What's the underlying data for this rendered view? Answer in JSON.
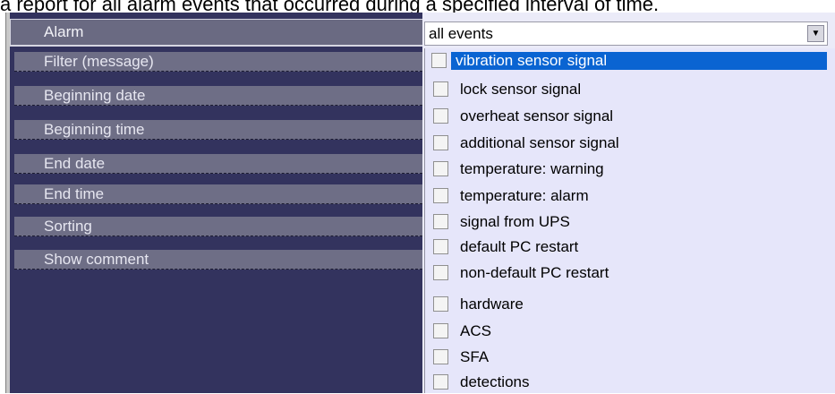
{
  "caption": "a report for all alarm events that occurred during a specified interval of time.",
  "properties": {
    "rows": [
      {
        "label": "Alarm"
      },
      {
        "label": "Filter (message)"
      },
      {
        "label": "Beginning date"
      },
      {
        "label": "Beginning time"
      },
      {
        "label": "End date"
      },
      {
        "label": "End time"
      },
      {
        "label": "Sorting"
      },
      {
        "label": "Show comment"
      }
    ]
  },
  "combo": {
    "value": "all events",
    "arrow_icon": "chevron-down-icon"
  },
  "dropdown": {
    "items": [
      {
        "label": "vibration sensor signal",
        "checked": false,
        "highlighted": true
      },
      {
        "label": "lock sensor signal",
        "checked": false
      },
      {
        "label": "overheat sensor signal",
        "checked": false
      },
      {
        "label": "additional sensor signal",
        "checked": false
      },
      {
        "label": "temperature: warning",
        "checked": false
      },
      {
        "label": "temperature: alarm",
        "checked": false
      },
      {
        "label": "signal from UPS",
        "checked": false
      },
      {
        "label": "default PC restart",
        "checked": false
      },
      {
        "label": "non-default PC restart",
        "checked": false
      },
      {
        "label": "hardware",
        "checked": false
      },
      {
        "label": "ACS",
        "checked": false
      },
      {
        "label": "SFA",
        "checked": false
      },
      {
        "label": "detections",
        "checked": false
      }
    ]
  },
  "colors": {
    "panel_bg": "#33335e",
    "row_bg": "#6e6e86",
    "dropdown_bg": "#e6e6fa",
    "highlight": "#0a64d2"
  }
}
